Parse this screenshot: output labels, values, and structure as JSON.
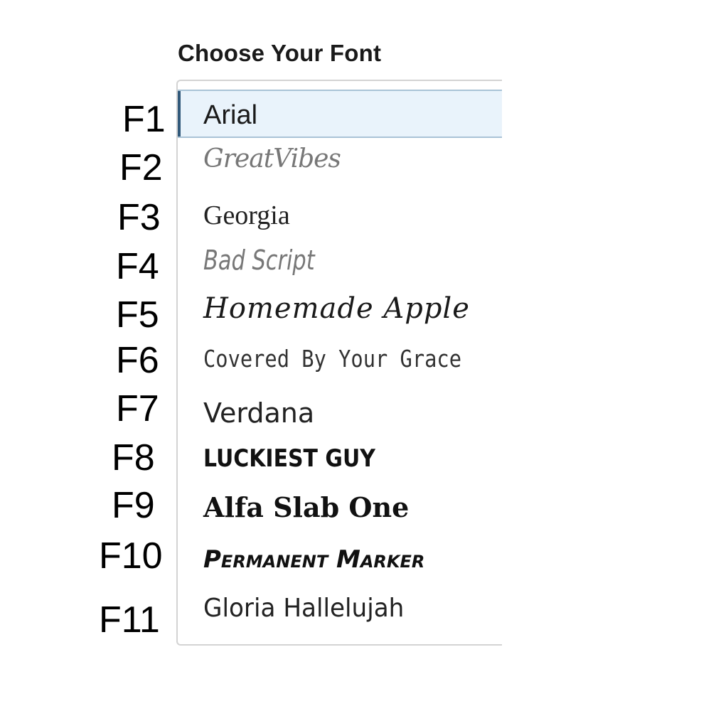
{
  "title": "Choose Your Font",
  "selected_index": 0,
  "fonts": [
    {
      "number": "F1",
      "name": "Arial"
    },
    {
      "number": "F2",
      "name": "GreatVibes"
    },
    {
      "number": "F3",
      "name": "Georgia"
    },
    {
      "number": "F4",
      "name": "Bad Script"
    },
    {
      "number": "F5",
      "name": "Homemade Apple"
    },
    {
      "number": "F6",
      "name": "Covered By Your Grace"
    },
    {
      "number": "F7",
      "name": "Verdana"
    },
    {
      "number": "F8",
      "name": "LUCKIEST GUY"
    },
    {
      "number": "F9",
      "name": "Alfa Slab One"
    },
    {
      "number": "F10",
      "name": "Permanent Marker"
    },
    {
      "number": "F11",
      "name": "Gloria Hallelujah"
    }
  ],
  "colors": {
    "selected_background": "#e9f3fb",
    "selected_accent": "#31597a",
    "panel_border": "#d3d3d3"
  }
}
